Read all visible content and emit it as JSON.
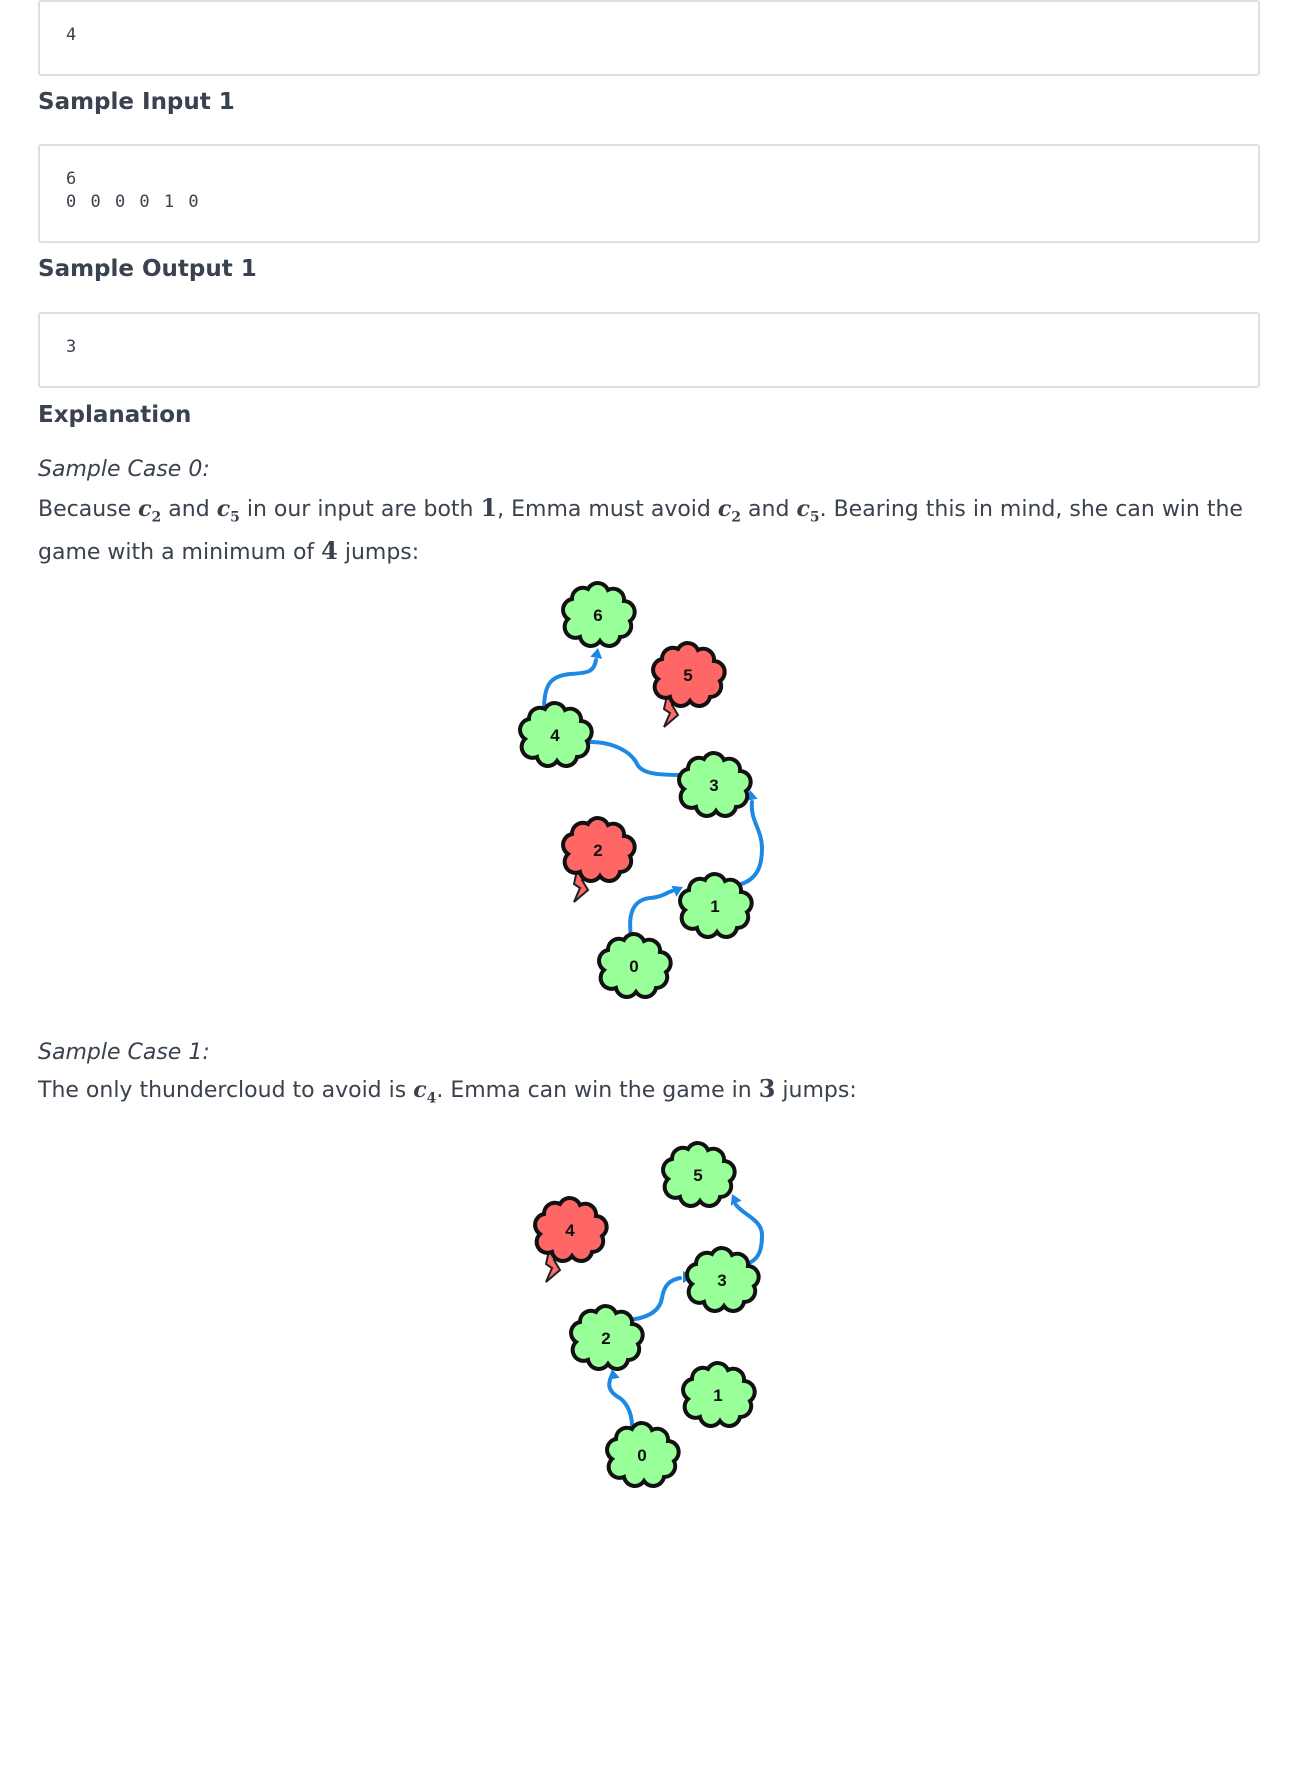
{
  "sample_output_0": {
    "lines": [
      "4"
    ]
  },
  "sample_input_1": {
    "heading": "Sample Input 1",
    "lines": [
      "6",
      "0 0 0 0 1 0"
    ]
  },
  "sample_output_1": {
    "heading": "Sample Output 1",
    "lines": [
      "3"
    ]
  },
  "explanation": {
    "heading": "Explanation",
    "case0": {
      "title": "Sample Case 0:",
      "text": {
        "p1": "Because ",
        "p2": " and ",
        "p3": " in our input are both ",
        "p4": ", Emma must avoid ",
        "p5": " and ",
        "p6": ". Bearing this in mind, she can win the game with a minimum of ",
        "p7": " jumps:"
      },
      "values": {
        "one": "1",
        "jumps": "4"
      },
      "var_c": "c",
      "subs": {
        "a": "2",
        "b": "5"
      }
    },
    "case1": {
      "title": "Sample Case 1:",
      "text": {
        "p1": "The only thundercloud to avoid is ",
        "p2": ". Emma can win the game in ",
        "p3": " jumps:"
      },
      "values": {
        "jumps": "3"
      },
      "var_c": "c",
      "sub": "4"
    }
  },
  "diagram0": {
    "clouds": [
      {
        "label": "0",
        "type": "cumulus"
      },
      {
        "label": "1",
        "type": "cumulus"
      },
      {
        "label": "2",
        "type": "thunder"
      },
      {
        "label": "3",
        "type": "cumulus"
      },
      {
        "label": "4",
        "type": "cumulus"
      },
      {
        "label": "5",
        "type": "thunder"
      },
      {
        "label": "6",
        "type": "cumulus"
      }
    ],
    "jumps": [
      [
        0,
        1
      ],
      [
        1,
        3
      ],
      [
        3,
        4
      ],
      [
        4,
        6
      ]
    ]
  },
  "diagram1": {
    "clouds": [
      {
        "label": "0",
        "type": "cumulus"
      },
      {
        "label": "1",
        "type": "cumulus"
      },
      {
        "label": "2",
        "type": "cumulus"
      },
      {
        "label": "3",
        "type": "cumulus"
      },
      {
        "label": "4",
        "type": "thunder"
      },
      {
        "label": "5",
        "type": "cumulus"
      }
    ],
    "jumps": [
      [
        0,
        2
      ],
      [
        2,
        3
      ],
      [
        3,
        5
      ]
    ]
  },
  "colors": {
    "cumulus": "#99ff99",
    "thunder": "#ff6666",
    "path": "#1e88e5"
  }
}
